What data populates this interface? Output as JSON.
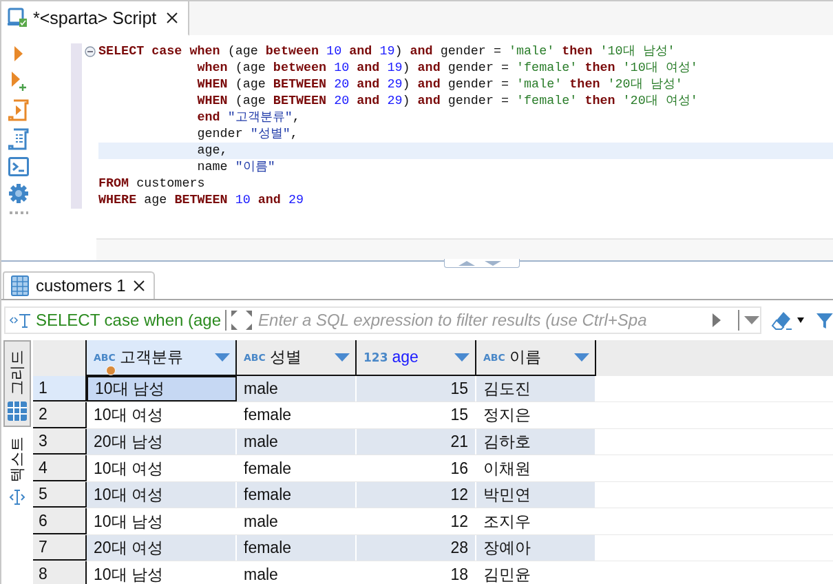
{
  "editor_tab": {
    "title": "*<sparta> Script",
    "selected": true
  },
  "code_lines": [
    {
      "highlighted": false,
      "indented": false,
      "fold": {
        "expanded": true
      },
      "tokens": [
        {
          "kind": "keyword",
          "text": "SELECT case when "
        },
        {
          "kind": "plain",
          "text": "(age "
        },
        {
          "kind": "keyword",
          "text": "between "
        },
        {
          "kind": "number",
          "text": "10 "
        },
        {
          "kind": "keyword",
          "text": "and "
        },
        {
          "kind": "number",
          "text": "19"
        },
        {
          "kind": "plain",
          "text": ") "
        },
        {
          "kind": "keyword",
          "text": "and"
        },
        {
          "kind": "plain",
          "text": " gender = "
        },
        {
          "kind": "string",
          "text": "'male' "
        },
        {
          "kind": "keyword",
          "text": "then "
        },
        {
          "kind": "string",
          "text": "'10대 남성'"
        }
      ]
    },
    {
      "highlighted": false,
      "indented": true,
      "tokens": [
        {
          "kind": "keyword",
          "text": "when "
        },
        {
          "kind": "plain",
          "text": "(age "
        },
        {
          "kind": "keyword",
          "text": "between "
        },
        {
          "kind": "number",
          "text": "10 "
        },
        {
          "kind": "keyword",
          "text": "and "
        },
        {
          "kind": "number",
          "text": "19"
        },
        {
          "kind": "plain",
          "text": ") "
        },
        {
          "kind": "keyword",
          "text": "and"
        },
        {
          "kind": "plain",
          "text": " gender = "
        },
        {
          "kind": "string",
          "text": "'female' "
        },
        {
          "kind": "keyword",
          "text": "then "
        },
        {
          "kind": "string",
          "text": "'10대 여성'"
        }
      ]
    },
    {
      "highlighted": false,
      "indented": true,
      "tokens": [
        {
          "kind": "keyword",
          "text": "WHEN "
        },
        {
          "kind": "plain",
          "text": "(age "
        },
        {
          "kind": "keyword",
          "text": "BETWEEN "
        },
        {
          "kind": "number",
          "text": "20 "
        },
        {
          "kind": "keyword",
          "text": "and "
        },
        {
          "kind": "number",
          "text": "29"
        },
        {
          "kind": "plain",
          "text": ") "
        },
        {
          "kind": "keyword",
          "text": "and"
        },
        {
          "kind": "plain",
          "text": " gender = "
        },
        {
          "kind": "string",
          "text": "'male' "
        },
        {
          "kind": "keyword",
          "text": "then "
        },
        {
          "kind": "string",
          "text": "'20대 남성'"
        }
      ]
    },
    {
      "highlighted": false,
      "indented": true,
      "tokens": [
        {
          "kind": "keyword",
          "text": "WHEN "
        },
        {
          "kind": "plain",
          "text": "(age "
        },
        {
          "kind": "keyword",
          "text": "BETWEEN "
        },
        {
          "kind": "number",
          "text": "20 "
        },
        {
          "kind": "keyword",
          "text": "and "
        },
        {
          "kind": "number",
          "text": "29"
        },
        {
          "kind": "plain",
          "text": ") "
        },
        {
          "kind": "keyword",
          "text": "and"
        },
        {
          "kind": "plain",
          "text": " gender = "
        },
        {
          "kind": "string",
          "text": "'female' "
        },
        {
          "kind": "keyword",
          "text": "then "
        },
        {
          "kind": "string",
          "text": "'20대 여성'"
        }
      ]
    },
    {
      "highlighted": false,
      "indented": true,
      "tokens": [
        {
          "kind": "keyword",
          "text": "end "
        },
        {
          "kind": "identifier",
          "text": "\"고객분류\""
        },
        {
          "kind": "plain",
          "text": ","
        }
      ]
    },
    {
      "highlighted": false,
      "indented": true,
      "tokens": [
        {
          "kind": "plain",
          "text": "gender "
        },
        {
          "kind": "identifier",
          "text": "\"성별\""
        },
        {
          "kind": "plain",
          "text": ","
        }
      ]
    },
    {
      "highlighted": true,
      "indented": true,
      "tokens": [
        {
          "kind": "plain",
          "text": "age,"
        }
      ]
    },
    {
      "highlighted": false,
      "indented": true,
      "tokens": [
        {
          "kind": "plain",
          "text": "name "
        },
        {
          "kind": "identifier",
          "text": "\"이름\""
        }
      ]
    },
    {
      "highlighted": false,
      "indented": false,
      "tokens": [
        {
          "kind": "keyword",
          "text": "FROM"
        },
        {
          "kind": "plain",
          "text": " customers"
        }
      ]
    },
    {
      "highlighted": false,
      "indented": false,
      "tokens": [
        {
          "kind": "keyword",
          "text": "WHERE"
        },
        {
          "kind": "plain",
          "text": " age "
        },
        {
          "kind": "keyword",
          "text": "BETWEEN "
        },
        {
          "kind": "number",
          "text": "10 "
        },
        {
          "kind": "keyword",
          "text": "and "
        },
        {
          "kind": "number",
          "text": "29"
        }
      ]
    }
  ],
  "results_tab": {
    "title": "customers 1",
    "selected": true
  },
  "filter": {
    "query": "SELECT case when (age",
    "placeholder": "Enter a SQL expression to filter results (use Ctrl+Spa"
  },
  "view_tabs": [
    {
      "label": "그리드",
      "selected": true
    },
    {
      "label": "텍스트",
      "selected": false
    }
  ],
  "table": {
    "columns": [
      {
        "type_label": "ABC",
        "name": "고객분류",
        "kind": "text",
        "selected": true,
        "marked": true
      },
      {
        "type_label": "ABC",
        "name": "성별",
        "kind": "text",
        "selected": false,
        "marked": false
      },
      {
        "type_label": "123",
        "name": "age",
        "kind": "number",
        "selected": false,
        "marked": false
      },
      {
        "type_label": "ABC",
        "name": "이름",
        "kind": "text",
        "selected": false,
        "marked": false
      }
    ],
    "rows": [
      {
        "number": "1",
        "selected": true,
        "cells": [
          "10대 남성",
          "male",
          "15",
          "김도진"
        ]
      },
      {
        "number": "2",
        "selected": false,
        "cells": [
          "10대 여성",
          "female",
          "15",
          "정지은"
        ]
      },
      {
        "number": "3",
        "selected": false,
        "cells": [
          "20대 남성",
          "male",
          "21",
          "김하호"
        ]
      },
      {
        "number": "4",
        "selected": false,
        "cells": [
          "10대 여성",
          "female",
          "16",
          "이채원"
        ]
      },
      {
        "number": "5",
        "selected": false,
        "cells": [
          "10대 여성",
          "female",
          "12",
          "박민연"
        ]
      },
      {
        "number": "6",
        "selected": false,
        "cells": [
          "10대 남성",
          "male",
          "12",
          "조지우"
        ]
      },
      {
        "number": "7",
        "selected": false,
        "cells": [
          "20대 여성",
          "female",
          "28",
          "장예아"
        ]
      },
      {
        "number": "8",
        "selected": false,
        "cells": [
          "10대 남성",
          "male",
          "18",
          "김민윤"
        ]
      }
    ]
  }
}
